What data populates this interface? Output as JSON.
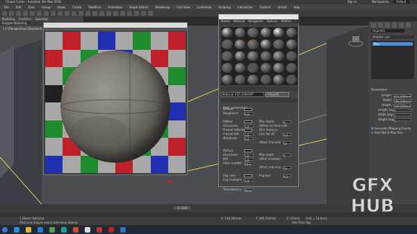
{
  "app": {
    "title": "Chapel 5.max - Autodesk 3ds Max 2018",
    "sign_in": "Sign In",
    "workspaces_label": "Workspaces:",
    "workspace": "Default"
  },
  "menu": [
    "File",
    "Edit",
    "Tools",
    "Group",
    "Views",
    "Create",
    "Modifiers",
    "Animation",
    "Graph Editors",
    "Rendering",
    "Civil View",
    "Customize",
    "Scripting",
    "Interactive",
    "Content",
    "Arnold",
    "Help"
  ],
  "ribbon": {
    "tabs": [
      "Modeling",
      "Freeform",
      "Selection"
    ],
    "sub": "Polygon Modeling"
  },
  "viewport_label": "[+] [Perspective] [Standard] [Default Shading]",
  "material_window": {
    "title": "Material #25 (VRAY-01)",
    "subtitle": "Auto"
  },
  "material_editor": {
    "title": "Material Editor - Arch88_004_wallGreyer",
    "menu": [
      "Modes",
      "Material",
      "Navigation",
      "Options",
      "Utilities"
    ],
    "material_name": "Material #25 (VRAYMT",
    "material_type": "VRayMtl",
    "rollout": "Basic parameters",
    "params": [
      {
        "label": "Diffuse",
        "value": ""
      },
      {
        "label": "Roughness",
        "value": "0,0"
      },
      {
        "label": "Reflect",
        "value": ""
      },
      {
        "label": "Glossiness",
        "value": "1,0"
      },
      {
        "label": "Fresnel reflections",
        "value": ""
      },
      {
        "label": "Fresnel IOR",
        "value": "1,6"
      },
      {
        "label": "Metalness",
        "value": "0,0"
      },
      {
        "label": "Refract",
        "value": ""
      },
      {
        "label": "Glossiness",
        "value": "1,0"
      },
      {
        "label": "IOR",
        "value": "1,6"
      },
      {
        "label": "Abbe number",
        "value": "50,0"
      },
      {
        "label": "Fog color",
        "value": ""
      },
      {
        "label": "Fog multiplier",
        "value": "1,0"
      },
      {
        "label": "Translucency",
        "value": "None"
      }
    ],
    "right_params": [
      {
        "label": "Max depth",
        "value": "5"
      },
      {
        "label": "Reflect on back side",
        "value": ""
      },
      {
        "label": "Dim distance",
        "value": ""
      },
      {
        "label": "Dim fall off",
        "value": "0,0"
      },
      {
        "label": "Affect channels",
        "value": "Co"
      },
      {
        "label": "Max depth",
        "value": "5"
      },
      {
        "label": "Affect shadows",
        "value": ""
      },
      {
        "label": "Affect channels",
        "value": "Co"
      },
      {
        "label": "Fog bias",
        "value": "0,0"
      }
    ]
  },
  "command_panel": {
    "object_name": "Object01",
    "modifier_list": "Modifier List",
    "modifier": "Box",
    "rollout": "Parameters",
    "params": [
      {
        "label": "Length:",
        "value": "421,000mm"
      },
      {
        "label": "Width:",
        "value": "280,000mm"
      },
      {
        "label": "Height:",
        "value": "280,000mm"
      },
      {
        "label": "Length Segs:",
        "value": "1"
      },
      {
        "label": "Width Segs:",
        "value": "1"
      },
      {
        "label": "Height Segs:",
        "value": "1"
      }
    ],
    "checkboxes": [
      "Generate Mapping Coords.",
      "Real-World Map Size"
    ]
  },
  "status": {
    "selection": "1 Object Selected",
    "prompt": "Click and drag to select and move objects",
    "x": "X: 130,381mm",
    "y": "Y: 285,534mm",
    "z": "Z: 0,0mm",
    "grid": "Grid = 10,0mm",
    "add_time_tag": "Add Time Tag",
    "frame": "0 / 100"
  },
  "colors": {
    "accent": "#4a90d9",
    "checker_red": "#c0202a",
    "checker_green": "#1e8b2c",
    "checker_blue": "#2030b0",
    "checker_grey": "#a8a8a8",
    "checker_dark": "#202020"
  },
  "logo_text": "GFX HUB"
}
